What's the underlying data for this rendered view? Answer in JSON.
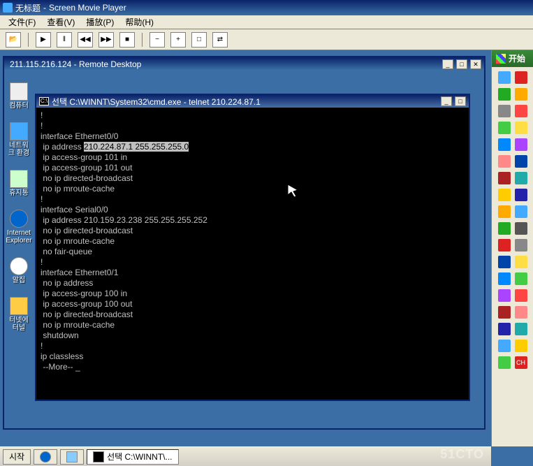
{
  "app": {
    "title_prefix": "无标题",
    "title_suffix": "Screen Movie Player"
  },
  "menus": {
    "file": "文件(F)",
    "view": "查看(V)",
    "play": "播放(P)",
    "help": "帮助(H)"
  },
  "toolbar_icons": {
    "open": "📂",
    "play": "▶",
    "pause": "‖",
    "prev": "◀◀",
    "next": "▶▶",
    "stop": "■",
    "minus": "−",
    "plus": "+",
    "restore": "□",
    "bal": "⇄"
  },
  "remote_desktop": {
    "title": "211.115.216.124 - Remote Desktop"
  },
  "desktop_icons": {
    "i0": "컴퓨터",
    "i1": "네트워크\n환경",
    "i2": "휴지통",
    "i3": "Internet\nExplorer",
    "i4": "알집",
    "i5": "터넷에\n터널"
  },
  "cmd": {
    "title": "선택 C:\\WINNT\\System32\\cmd.exe - telnet 210.224.87.1",
    "lines": {
      "l0": "!",
      "l1": "!",
      "l2": "interface Ethernet0/0",
      "l3a": " ip address ",
      "l3h": "210.224.87.1 255.255.255.0",
      "l4": " ip access-group 101 in",
      "l5": " ip access-group 101 out",
      "l6": " no ip directed-broadcast",
      "l7": " no ip mroute-cache",
      "l8": "!",
      "l9": "interface Serial0/0",
      "l10": " ip address 210.159.23.238 255.255.255.252",
      "l11": " no ip directed-broadcast",
      "l12": " no ip mroute-cache",
      "l13": " no fair-queue",
      "l14": "!",
      "l15": "interface Ethernet0/1",
      "l16": " no ip address",
      "l17": " ip access-group 100 in",
      "l18": " ip access-group 100 out",
      "l19": " no ip directed-broadcast",
      "l20": " no ip mroute-cache",
      "l21": " shutdown",
      "l22": "!",
      "l23": "ip classless",
      "l24": " --More-- _"
    }
  },
  "right_dock": {
    "start": "开始"
  },
  "taskbar": {
    "start": "시작",
    "task1": "선택 C:\\WINNT\\..."
  },
  "watermark": "51CTO",
  "tray_lang": "CH"
}
